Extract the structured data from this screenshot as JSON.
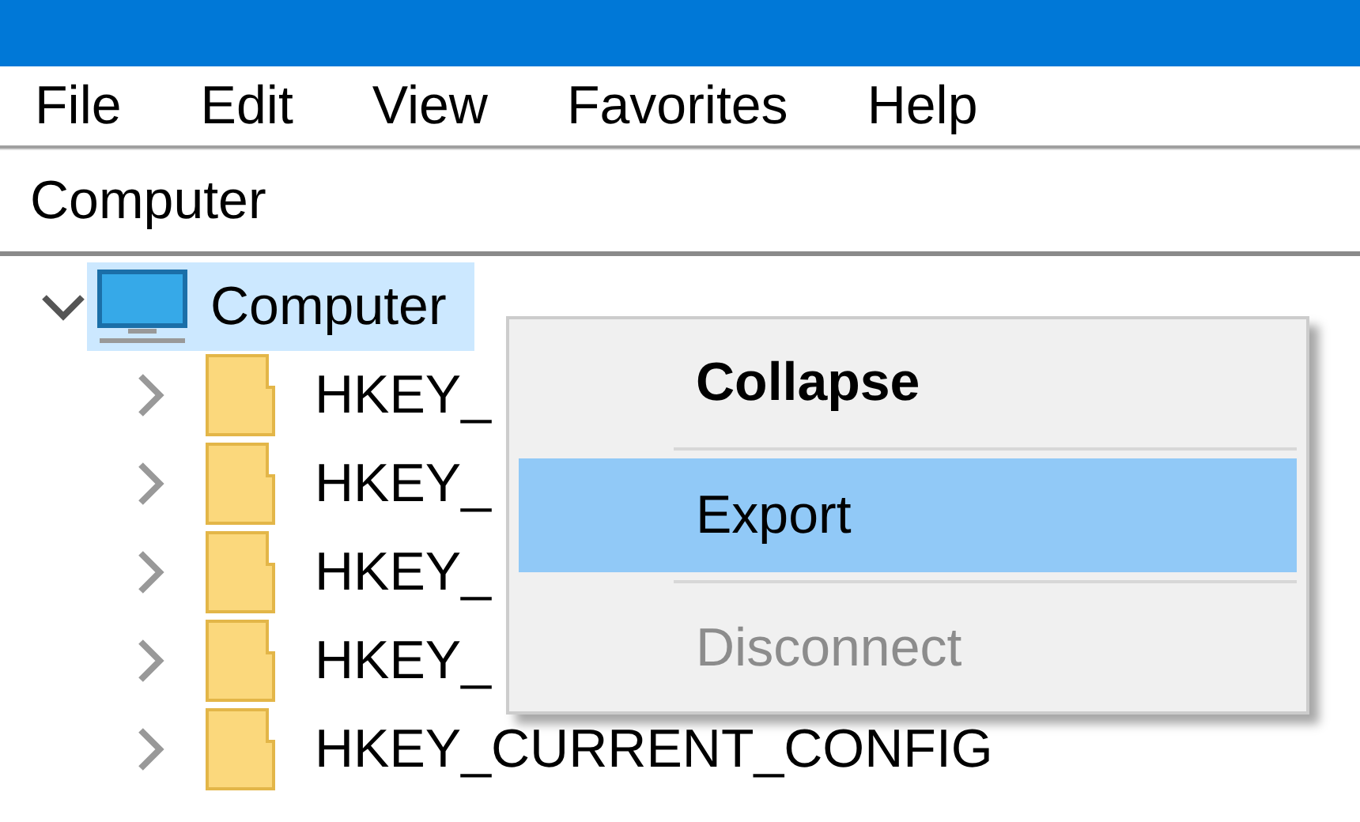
{
  "menu_bar": [
    {
      "label": "File"
    },
    {
      "label": "Edit"
    },
    {
      "label": "View"
    },
    {
      "label": "Favorites"
    },
    {
      "label": "Help"
    }
  ],
  "address_bar": {
    "value": "Computer"
  },
  "tree": {
    "label": "Computer",
    "expanded": true,
    "selected": true,
    "children": [
      {
        "label": "HKEY_",
        "expanded": false
      },
      {
        "label": "HKEY_",
        "expanded": false
      },
      {
        "label": "HKEY_",
        "expanded": false
      },
      {
        "label": "HKEY_",
        "expanded": false
      },
      {
        "label": "HKEY_CURRENT_CONFIG",
        "expanded": false
      }
    ]
  },
  "context_menu": [
    {
      "label": "Collapse",
      "default": true,
      "selected": false,
      "disabled": false
    },
    {
      "label": "Export",
      "default": false,
      "selected": true,
      "disabled": false
    },
    {
      "label": "Disconnect",
      "default": false,
      "selected": false,
      "disabled": true
    }
  ]
}
